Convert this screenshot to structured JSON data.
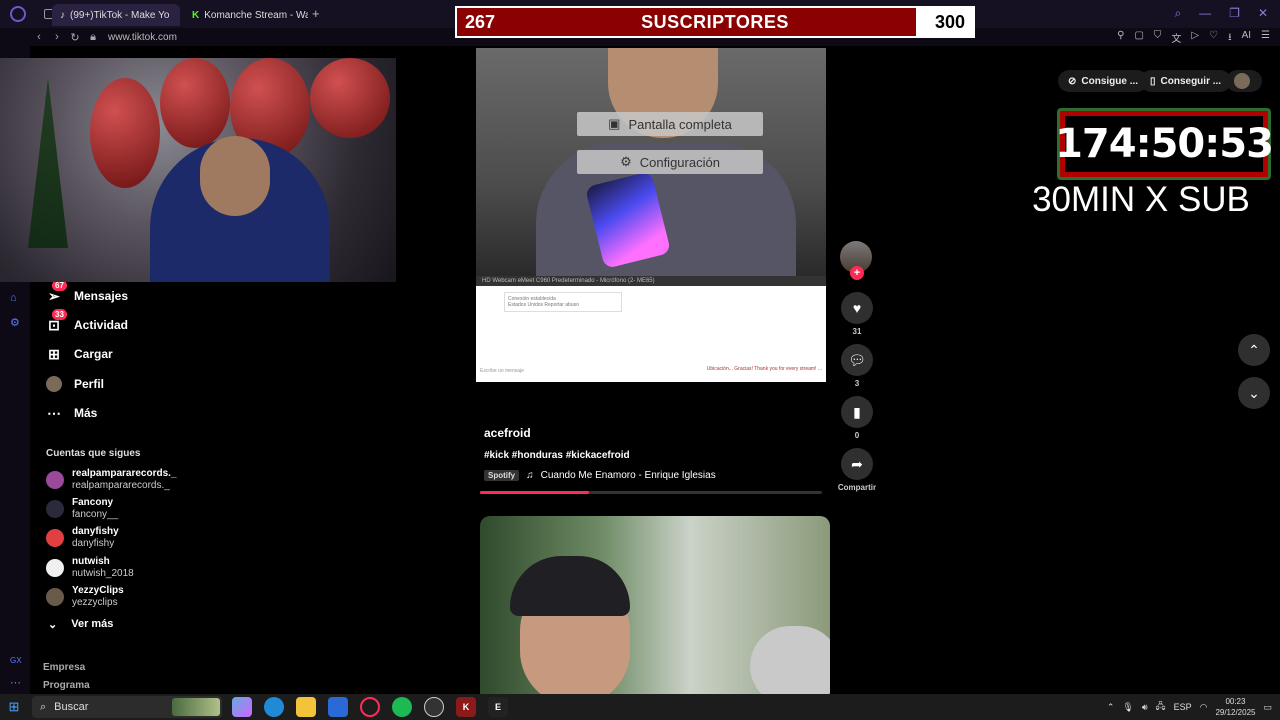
{
  "browser": {
    "tabs": [
      {
        "label": "(99+)TikTok - Make Yo",
        "active": true
      },
      {
        "label": "Komanche Stream - Watch"
      }
    ],
    "new_tab": "+",
    "url": "www.tiktok.com",
    "window_controls": [
      "search-icon",
      "minimize-icon",
      "restore-icon",
      "close-icon"
    ]
  },
  "overlay": {
    "sub_goal": {
      "current": "267",
      "title": "SUSCRIPTORES",
      "goal": "300",
      "progress": 0.89
    },
    "timer": "174:50:53",
    "timer_label": "30MIN X SUB"
  },
  "header_right": {
    "get_coins": "Consigue ...",
    "get_app": "Conseguir ..."
  },
  "sidebar": {
    "items": [
      {
        "label": "Mensajes",
        "badge": "67",
        "icon": "paper-plane-icon"
      },
      {
        "label": "Actividad",
        "badge": "33",
        "icon": "inbox-icon"
      },
      {
        "label": "Cargar",
        "icon": "plus-square-icon"
      },
      {
        "label": "Perfil",
        "icon": "avatar"
      },
      {
        "label": "Más",
        "icon": "more-icon"
      }
    ],
    "following_title": "Cuentas que sigues",
    "following": [
      {
        "name": "realpampararecords._",
        "handle": "realpampararecords._",
        "color": "#9a4a9a"
      },
      {
        "name": "Fancony",
        "handle": "fancony__",
        "color": "#2a2a3a"
      },
      {
        "name": "danyfishy",
        "handle": "danyfishy",
        "color": "#e04040"
      },
      {
        "name": "nutwish",
        "handle": "nutwish_2018",
        "color": "#f0f0f0"
      },
      {
        "name": "YezzyClips",
        "handle": "yezzyclips",
        "color": "#6a5a4a"
      }
    ],
    "see_more": "Ver más",
    "footer": [
      "Empresa",
      "Programa"
    ]
  },
  "video": {
    "context_menu": [
      "Pantalla completa",
      "Configuración"
    ],
    "device_strip": "HD Webcam eMeet C960          Predeterminado - Micrófono (2- ME65)",
    "chip_text_1": "Conexión establecida",
    "chip_text_2": "Estados Unidos  Reportar abuso",
    "footer_left": "Escribe un mensaje",
    "footer_right": "Ubicación... Gracias! Thank you for every stream! ...",
    "username": "acefroid",
    "tags": "#kick #honduras #kickacefroid",
    "spotify": "Spotify",
    "music": "Cuando Me Enamoro - Enrique Iglesias",
    "progress": 0.32
  },
  "actions": {
    "likes": "31",
    "comments": "3",
    "saves": "0",
    "share": "Compartir"
  },
  "taskbar": {
    "search": "Buscar",
    "lang": "ESP",
    "time": "00:23",
    "date": "29/12/2025"
  }
}
